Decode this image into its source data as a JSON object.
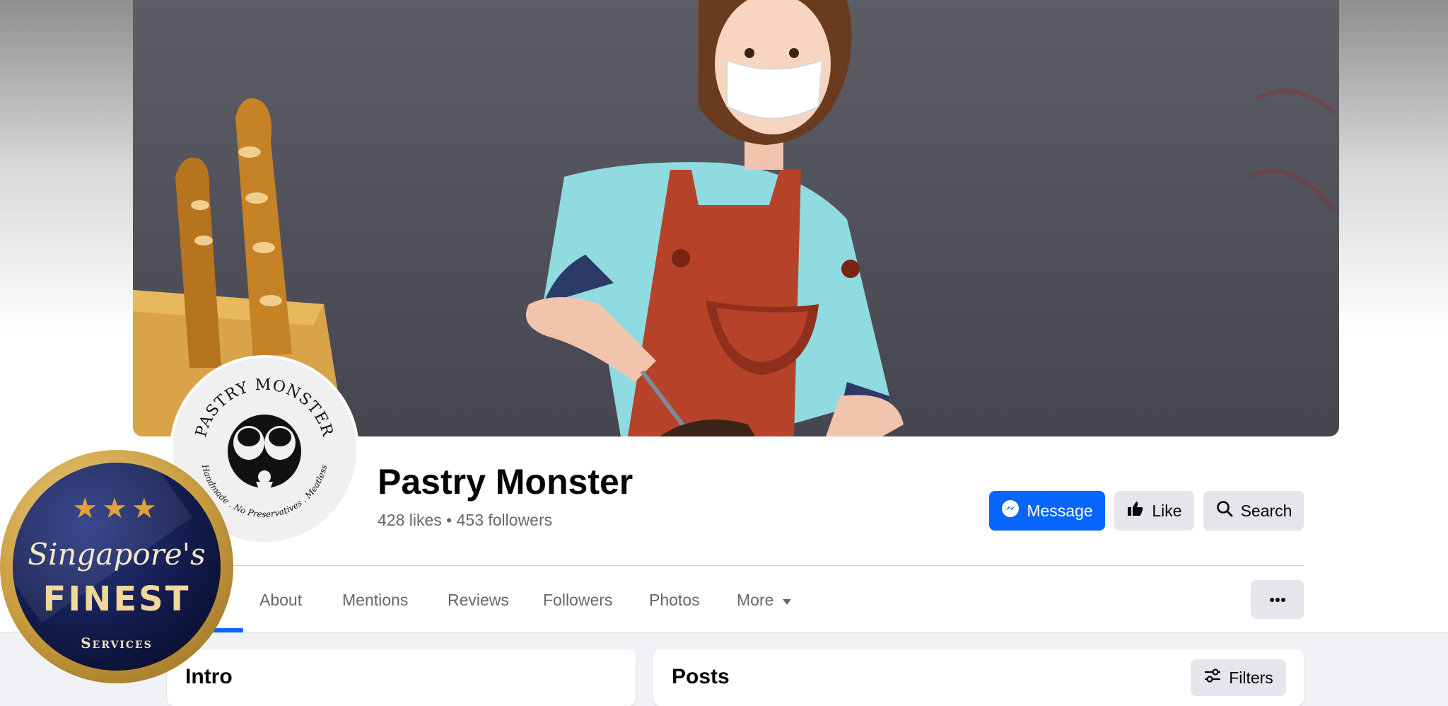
{
  "page": {
    "name": "Pastry Monster",
    "stats": "428 likes • 453 followers"
  },
  "logo": {
    "arc_text": "PASTRY MONSTER",
    "tagline": "Handmade . No Preservatives . Meatless"
  },
  "actions": {
    "message_label": "Message",
    "like_label": "Like",
    "search_label": "Search"
  },
  "tabs": [
    {
      "label": "About"
    },
    {
      "label": "Mentions"
    },
    {
      "label": "Reviews"
    },
    {
      "label": "Followers"
    },
    {
      "label": "Photos"
    },
    {
      "label": "More"
    }
  ],
  "cards": {
    "intro_title": "Intro",
    "posts_title": "Posts",
    "filters_label": "Filters"
  },
  "badge": {
    "stars": "★★★",
    "script": "Singapore's",
    "finest": "FINEST",
    "services": "Services"
  },
  "colors": {
    "accent": "#0866ff",
    "secondary_button": "#e4e6eb",
    "page_background": "#f0f2f5"
  },
  "icons": {
    "message": "messenger-icon",
    "like": "thumbs-up-icon",
    "search": "search-icon",
    "more": "caret-down-icon",
    "options": "ellipsis-icon",
    "filters": "sliders-icon"
  }
}
